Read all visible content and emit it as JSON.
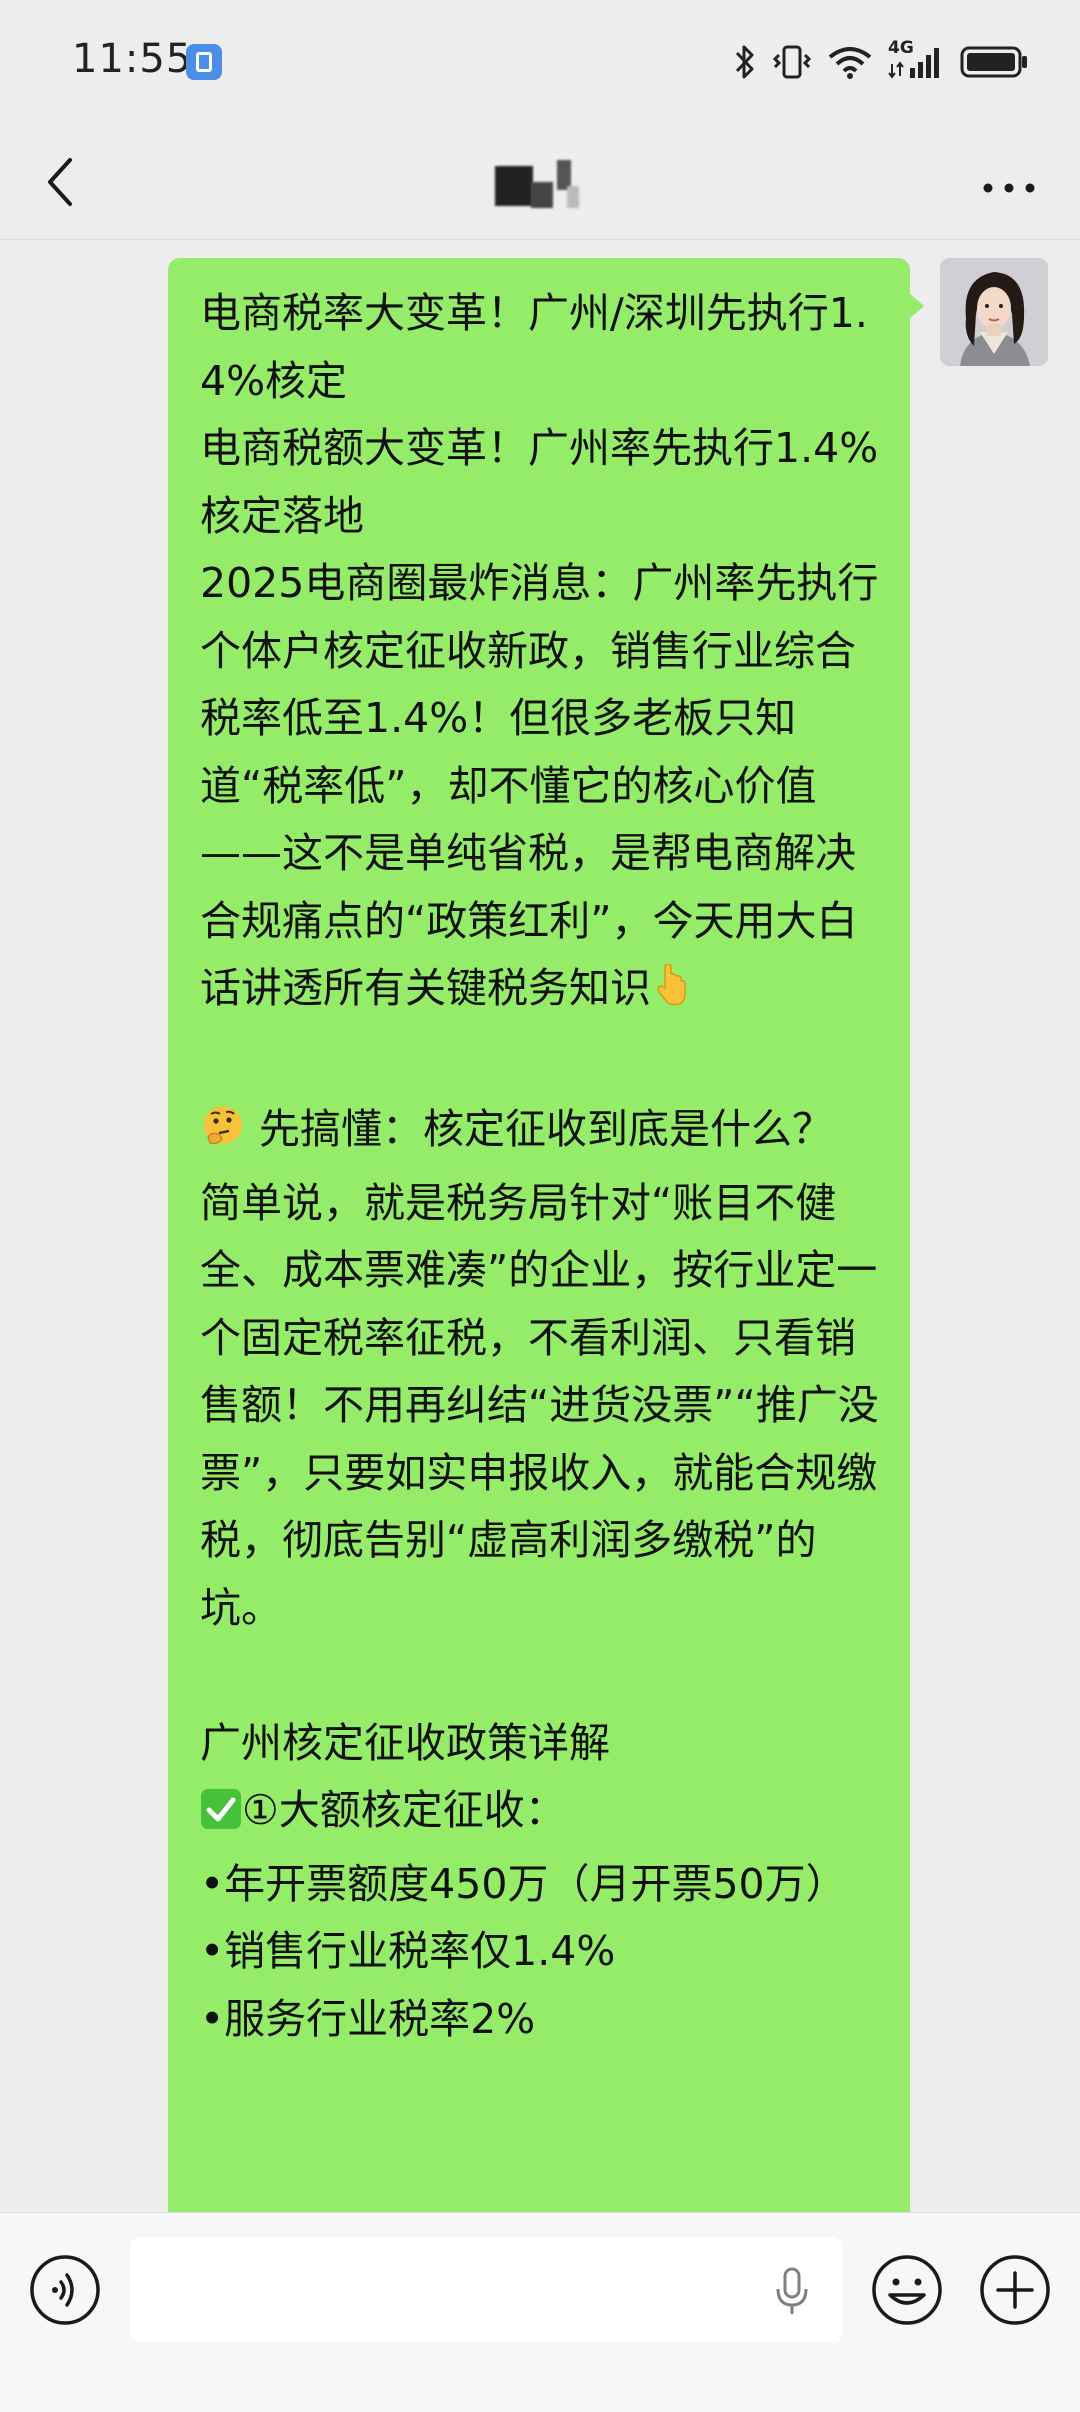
{
  "status_bar": {
    "time": "11:55",
    "network_label": "4G",
    "icons": [
      "app-notification-icon",
      "bluetooth-icon",
      "vibrate-icon",
      "wifi-icon",
      "cellular-signal-icon",
      "battery-icon"
    ]
  },
  "nav": {
    "title": "",
    "back_icon": "chevron-left-icon",
    "more_icon": "more-dots-icon"
  },
  "message": {
    "sender": "self",
    "bubble_color": "#95ec69",
    "parts": [
      {
        "type": "text",
        "text": "电商税率大变革！广州/深圳先执行1.4%核定\n电商税额大变革！广州率先执行1.4%核定落地\n2025电商圈最炸消息：广州率先执行个体户核定征收新政，销售行业综合税率低至1.4%！但很多老板只知道“税率低”，却不懂它的核心价值——这不是单纯省税，是帮电商解决合规痛点的“政策红利”，今天用大白话讲透所有关键税务知识"
      },
      {
        "type": "emoji",
        "icon": "pointing-down-emoji"
      },
      {
        "type": "text",
        "text": "\n\n"
      },
      {
        "type": "emoji",
        "icon": "thinking-face-emoji"
      },
      {
        "type": "text",
        "text": " 先搞懂：核定征收到底是什么？\n简单说，就是税务局针对“账目不健全、成本票难凑”的企业，按行业定一个固定税率征税，不看利润、只看销售额！不用再纠结“进货没票”“推广没票”，只要如实申报收入，就能合规缴税，彻底告别“虚高利润多缴税”的坑。\n\n广州核定征收政策详解\n"
      },
      {
        "type": "emoji",
        "icon": "check-mark-emoji"
      },
      {
        "type": "text",
        "text": "①大额核定征收：\n•年开票额度450万（月开票50万）\n•销售行业税率仅1.4%\n•服务行业税率2%"
      }
    ]
  },
  "input_bar": {
    "placeholder": "",
    "icons": [
      "voice-icon",
      "microphone-icon",
      "emoji-icon",
      "plus-icon"
    ]
  }
}
